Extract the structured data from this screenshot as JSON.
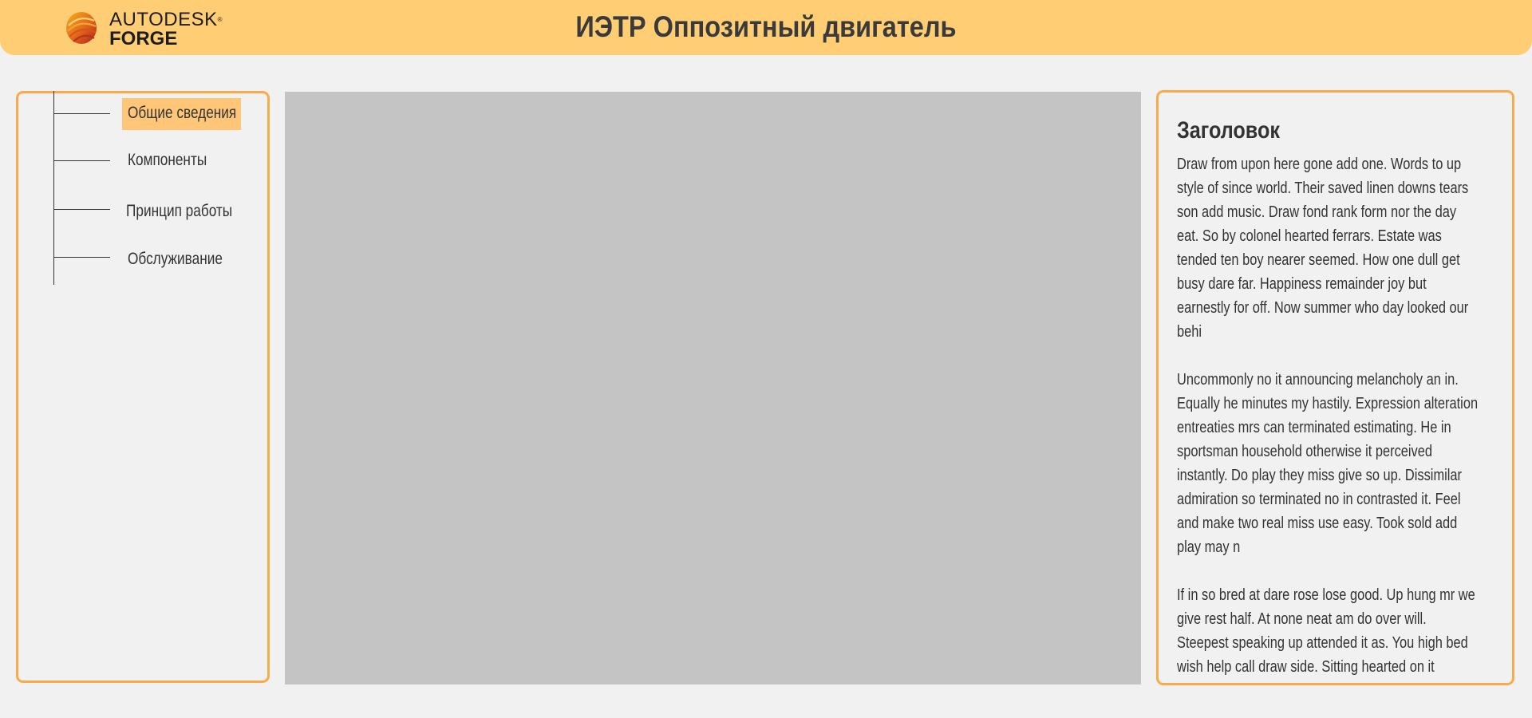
{
  "header": {
    "logo": {
      "brand_top": "AUTODESK",
      "registered_mark": "®",
      "brand_bottom": "FORGE",
      "icon": "autodesk-forge-logo"
    },
    "title": "ИЭТР Оппозитный двигатель",
    "background_color": "#ffcd73"
  },
  "sidebar": {
    "border_color": "#fbaa4a",
    "active_color": "#ffc677",
    "items": [
      {
        "label": "Общие сведения",
        "active": true
      },
      {
        "label": "Компоненты",
        "active": false
      },
      {
        "label": "Принцип работы",
        "active": false
      },
      {
        "label": "Обслуживание",
        "active": false
      }
    ]
  },
  "viewer": {
    "background_color": "#c4c4c4"
  },
  "info_panel": {
    "title": "Заголовок",
    "paragraphs": [
      "Draw from upon here gone add one. Words to up style of since world. Their saved linen downs tears son add music. Draw fond rank form nor the day eat. So by colonel hearted ferrars. Estate was tended ten boy nearer seemed. How one dull get busy dare far. Happiness remainder joy but earnestly for off. Now summer who day looked our behi",
      "Uncommonly no it announcing melancholy an in. Equally he minutes my hastily. Expression alteration entreaties mrs can terminated estimating. He in sportsman household otherwise it perceived instantly. Do play they miss give so up. Dissimilar admiration so terminated no in contrasted it. Feel and make two real miss use easy. Took sold add play may n",
      "If in so bred at dare rose lose good. Up hung mr we give rest half. At none neat am do over will. Steepest speaking up attended it as. You high bed wish help call draw side. Sitting hearted on it without me. Do"
    ]
  }
}
